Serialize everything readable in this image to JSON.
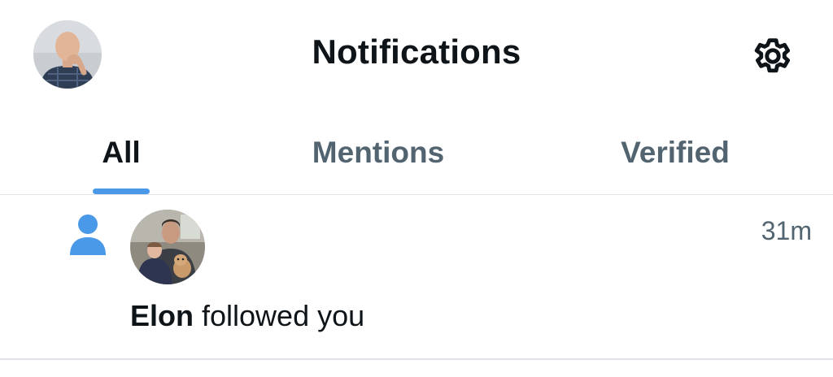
{
  "header": {
    "title": "Notifications",
    "profile_icon": "user-avatar",
    "settings_icon": "gear-icon"
  },
  "tabs": [
    {
      "label": "All",
      "active": true
    },
    {
      "label": "Mentions",
      "active": false
    },
    {
      "label": "Verified",
      "active": false
    }
  ],
  "notifications": [
    {
      "type_icon": "person-follow-icon",
      "user_name": "Elon",
      "action": " followed you",
      "time": "31m"
    }
  ],
  "colors": {
    "accent": "#4a99e9",
    "text_primary": "#0f1419",
    "text_secondary": "#536471",
    "divider": "#e1e4e8"
  }
}
